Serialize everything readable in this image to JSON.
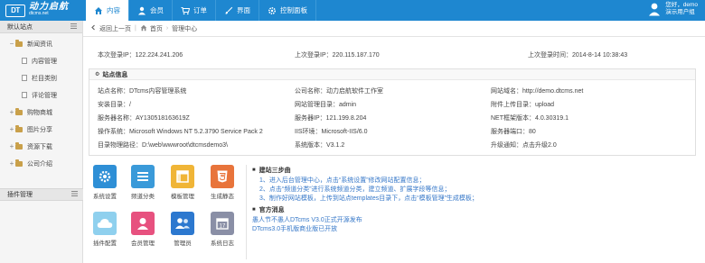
{
  "app": {
    "logo_short": "DT",
    "logo_cn": "动力启航",
    "logo_en": "dtcms.net"
  },
  "nav": [
    {
      "label": "内容",
      "icon": "home-icon",
      "active": true
    },
    {
      "label": "会员",
      "icon": "user-icon"
    },
    {
      "label": "订单",
      "icon": "cart-icon"
    },
    {
      "label": "界面",
      "icon": "brush-icon"
    },
    {
      "label": "控制面板",
      "icon": "gear-icon"
    }
  ],
  "user": {
    "greeting": "您好，demo",
    "role": "演示用户组"
  },
  "sidebar": {
    "header": "默认站点",
    "items": [
      {
        "label": "新闻资讯",
        "level": 0,
        "expanded": true
      },
      {
        "label": "内容管理",
        "level": 1
      },
      {
        "label": "栏目类别",
        "level": 1
      },
      {
        "label": "评论管理",
        "level": 1
      },
      {
        "label": "购物商城",
        "level": 0
      },
      {
        "label": "图片分享",
        "level": 0
      },
      {
        "label": "资源下载",
        "level": 0
      },
      {
        "label": "公司介绍",
        "level": 0
      }
    ],
    "header2": "插件管理"
  },
  "breadcrumb": {
    "back": "返回上一页",
    "home": "首页",
    "current": "管理中心"
  },
  "login": {
    "this_ip": "本次登录IP：122.224.241.206",
    "last_ip": "上次登录IP：220.115.187.170",
    "last_time": "上次登录时间：2014-8-14 10:38:43"
  },
  "site_info": {
    "title": "站点信息",
    "rows": [
      [
        "站点名称：DTcms内容管理系统",
        "公司名称：动力启航软件工作室",
        "网站域名：http://demo.dtcms.net"
      ],
      [
        "安装目录：/",
        "网站管理目录：admin",
        "附件上传目录：upload"
      ],
      [
        "服务器名称：AY130518163619Z",
        "服务器IP：121.199.8.204",
        "NET框架版本：4.0.30319.1"
      ],
      [
        "操作系统：Microsoft Windows NT 5.2.3790 Service Pack 2",
        "IIS环境：Microsoft-IIS/6.0",
        "服务器端口：80"
      ],
      [
        "目录物理路径：D:\\web\\wwwroot\\dtcmsdemo3\\",
        "系统版本：V3.1.2",
        "升级通知：点击升级2.0"
      ]
    ]
  },
  "shortcuts": [
    {
      "label": "系统设置",
      "icon": "settings-icon",
      "color": "#2e8fd6"
    },
    {
      "label": "频道分类",
      "icon": "channel-icon",
      "color": "#3a9ad9"
    },
    {
      "label": "模板管理",
      "icon": "template-icon",
      "color": "#f0b537"
    },
    {
      "label": "生成静态",
      "icon": "html5-icon",
      "color": "#e8743b"
    },
    {
      "label": "插件配置",
      "icon": "cloud-icon",
      "color": "#8fd0ee"
    },
    {
      "label": "会员管理",
      "icon": "member-icon",
      "color": "#e7517f"
    },
    {
      "label": "管理员",
      "icon": "admin-icon",
      "color": "#2c78cf"
    },
    {
      "label": "系统日志",
      "icon": "calendar-icon",
      "color": "#8a8fa6"
    }
  ],
  "build_steps": {
    "title": "建站三步曲",
    "steps": [
      "1、进入后台管理中心，点击“系统设置”修改网站配置信息；",
      "2、点击“频道分类”进行系统频道分类，建立频道、扩展字段等信息；",
      "3、制作好网站模板，上传到站点templates目录下，点击“模板管理”生成模板；"
    ]
  },
  "news": {
    "title": "官方消息",
    "items": [
      "愚人节不愚人DTcms V3.0正式开源发布",
      "DTcms3.0手机版商业版已开放"
    ]
  }
}
